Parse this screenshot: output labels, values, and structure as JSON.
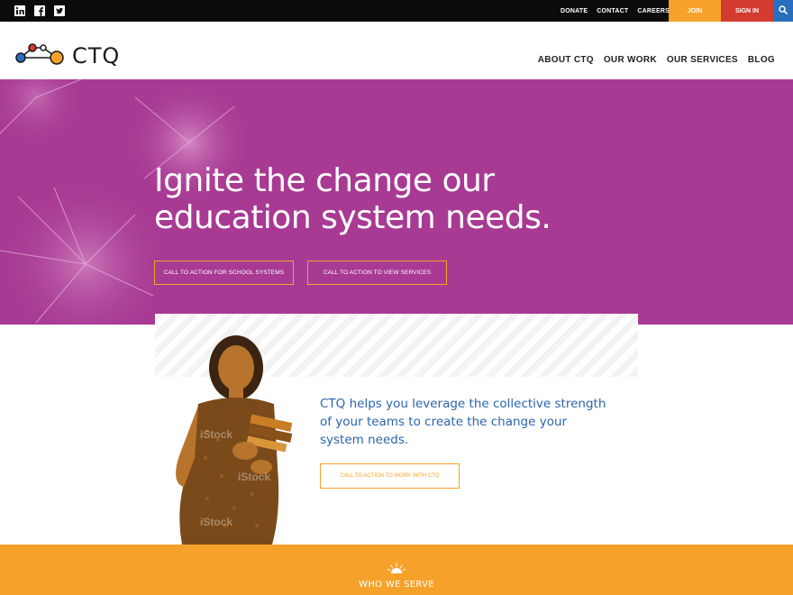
{
  "topbar": {
    "social": [
      {
        "name": "linkedin-icon"
      },
      {
        "name": "facebook-icon"
      },
      {
        "name": "twitter-icon"
      }
    ],
    "links": [
      "DONATE",
      "CONTACT",
      "CAREERS"
    ],
    "join_label": "JOIN",
    "signin_label": "SIGN IN",
    "search_icon": "search-icon"
  },
  "header": {
    "logo_text": "CTQ",
    "nav": [
      "ABOUT CTQ",
      "OUR WORK",
      "OUR SERVICES",
      "BLOG"
    ]
  },
  "hero": {
    "title_line1": "Ignite the change our",
    "title_line2": "education system needs.",
    "cta_school": "CALL TO ACTION FOR SCHOOL SYSTEMS",
    "cta_services": "CALL TO ACTION TO VIEW SERVICES"
  },
  "feature": {
    "watermark": "iStock",
    "text": "CTQ helps you leverage the collective strength of your teams to create the change your system needs.",
    "cta": "CALL TO ACTION TO WORK WITH CTQ"
  },
  "band": {
    "title": "WHO WE SERVE"
  },
  "colors": {
    "topbar": "#0b0b0b",
    "join": "#f6a22a",
    "signin": "#d33b2e",
    "search": "#2a6fbf",
    "hero": "#a83a93",
    "accent": "#f6a22a",
    "feature_text": "#2a64ad"
  }
}
